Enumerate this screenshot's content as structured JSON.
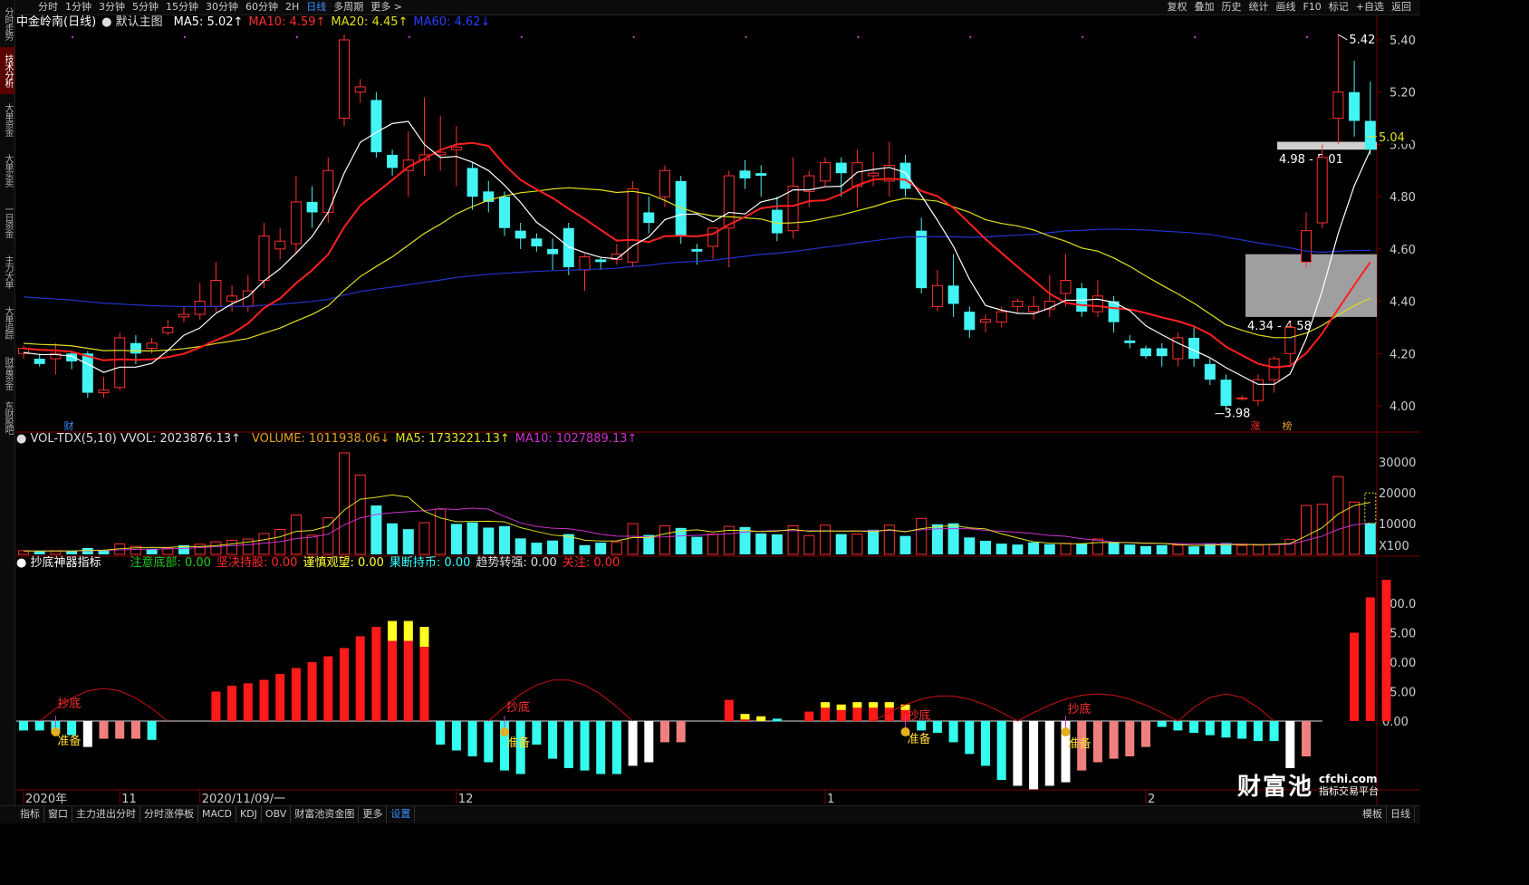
{
  "topbar": {
    "left": [
      "分时",
      "1分钟",
      "3分钟",
      "5分钟",
      "15分钟",
      "30分钟",
      "60分钟",
      "2H",
      "日线",
      "多周期",
      "更多 >"
    ],
    "active": "日线",
    "right": [
      "复权",
      "叠加",
      "历史",
      "统计",
      "画线",
      "F10",
      "标记",
      "+自选",
      "返回"
    ]
  },
  "leftbar": {
    "items": [
      "分时走势",
      "技术分析",
      "大单资金",
      "大单买卖",
      "一日资金",
      "主力大单",
      "大单追踪",
      "财富资金",
      "东财股吧"
    ],
    "active": "技术分析"
  },
  "bottombar": {
    "left": [
      "指标",
      "窗口",
      "主力进出分时",
      "分时涨停板",
      "MACD",
      "KDJ",
      "OBV",
      "财富池资金图",
      "更多",
      "设置"
    ],
    "active": "设置",
    "right": [
      "模板",
      "日线"
    ]
  },
  "header_main": {
    "title": "中金岭南(日线)",
    "template": "默认主图",
    "ma5": "MA5: 5.02↑",
    "ma10": "MA10: 4.59↑",
    "ma20": "MA20: 4.45↑",
    "ma60": "MA60: 4.62↓"
  },
  "header_vol": {
    "title": "VOL-TDX(5,10) VVOL: 2023876.13↑",
    "volume": "VOLUME: 1011938.06↓",
    "ma5": "MA5: 1733221.13↑",
    "ma10": "MA10: 1027889.13↑"
  },
  "header_ind": {
    "title": "抄底神器指标",
    "items": [
      {
        "text": "注意底部: 0.00",
        "color": "#22cc22"
      },
      {
        "text": "坚决持股: 0.00",
        "color": "#ff2a2a"
      },
      {
        "text": "谨慎观望: 0.00",
        "color": "#ffff33"
      },
      {
        "text": "果断持币: 0.00",
        "color": "#33ffff"
      },
      {
        "text": "趋势转强: 0.00",
        "color": "#dddddd"
      },
      {
        "text": "关注: 0.00",
        "color": "#ff2a2a"
      }
    ]
  },
  "price_axis": [
    "5.40",
    "5.20",
    "5.00",
    "4.80",
    "4.60",
    "4.40",
    "4.20",
    "4.00"
  ],
  "price_axis_vals": [
    5.4,
    5.2,
    5.0,
    4.8,
    4.6,
    4.4,
    4.2,
    4.0
  ],
  "vol_axis": [
    "30000",
    "20000",
    "10000",
    "X100"
  ],
  "vol_axis_vals": [
    30000,
    20000,
    10000
  ],
  "ind_axis": [
    "100.0",
    "75.00",
    "50.00",
    "25.00",
    "0.00"
  ],
  "ind_axis_vals": [
    100,
    75,
    50,
    25,
    0
  ],
  "date_axis": [
    {
      "label": "2020年",
      "i": 0
    },
    {
      "label": "11",
      "i": 6
    },
    {
      "label": "2020/11/09/一",
      "i": 11
    },
    {
      "label": "12",
      "i": 27
    },
    {
      "label": "1",
      "i": 50
    },
    {
      "label": "2",
      "i": 70
    }
  ],
  "annotations": {
    "high": "5.42",
    "low": "3.98",
    "last": "5.04",
    "zone1": "4.98 - 5.01",
    "zone2": "4.34 - 4.58",
    "cai": "财",
    "zhang": "涨",
    "bang": "榜",
    "chaodi": "抄底",
    "zhunbei": "准备"
  },
  "colors": {
    "up": "#ff3030",
    "down": "#44f4f4",
    "ma5": "#ffffff",
    "ma10": "#ff2020",
    "ma20": "#e0e020",
    "ma60": "#2233cc",
    "vol_ma5": "#e0e020",
    "vol_ma10": "#cc33cc"
  },
  "watermark": {
    "logo": "财富池",
    "site": "cfchi.com",
    "slogan": "指标交易平台"
  },
  "chart_data": {
    "type": "candlestick",
    "candles": [
      [
        4.2,
        4.22,
        4.18,
        4.23
      ],
      [
        4.18,
        4.16,
        4.15,
        4.2
      ],
      [
        4.18,
        4.2,
        4.12,
        4.24
      ],
      [
        4.2,
        4.17,
        4.14,
        4.21
      ],
      [
        4.2,
        4.05,
        4.03,
        4.21
      ],
      [
        4.05,
        4.06,
        4.03,
        4.11
      ],
      [
        4.07,
        4.26,
        4.06,
        4.28
      ],
      [
        4.24,
        4.2,
        4.16,
        4.27
      ],
      [
        4.22,
        4.24,
        4.2,
        4.26
      ],
      [
        4.28,
        4.3,
        4.27,
        4.33
      ],
      [
        4.34,
        4.35,
        4.32,
        4.38
      ],
      [
        4.35,
        4.4,
        4.33,
        4.47
      ],
      [
        4.38,
        4.48,
        4.36,
        4.55
      ],
      [
        4.4,
        4.42,
        4.36,
        4.46
      ],
      [
        4.38,
        4.44,
        4.36,
        4.5
      ],
      [
        4.48,
        4.65,
        4.45,
        4.7
      ],
      [
        4.6,
        4.63,
        4.56,
        4.68
      ],
      [
        4.62,
        4.78,
        4.58,
        4.88
      ],
      [
        4.78,
        4.74,
        4.68,
        4.84
      ],
      [
        4.74,
        4.9,
        4.7,
        4.95
      ],
      [
        5.1,
        5.4,
        5.07,
        5.42
      ],
      [
        5.2,
        5.22,
        5.16,
        5.25
      ],
      [
        5.17,
        4.97,
        4.95,
        5.2
      ],
      [
        4.96,
        4.91,
        4.88,
        4.98
      ],
      [
        4.9,
        4.94,
        4.8,
        5.05
      ],
      [
        4.94,
        4.96,
        4.88,
        5.18
      ],
      [
        4.96,
        4.97,
        4.9,
        5.11
      ],
      [
        4.98,
        4.99,
        4.84,
        5.07
      ],
      [
        4.91,
        4.8,
        4.75,
        4.93
      ],
      [
        4.82,
        4.78,
        4.74,
        4.86
      ],
      [
        4.8,
        4.68,
        4.65,
        4.82
      ],
      [
        4.67,
        4.64,
        4.6,
        4.7
      ],
      [
        4.64,
        4.61,
        4.59,
        4.66
      ],
      [
        4.6,
        4.58,
        4.52,
        4.64
      ],
      [
        4.68,
        4.53,
        4.5,
        4.7
      ],
      [
        4.52,
        4.57,
        4.44,
        4.58
      ],
      [
        4.56,
        4.55,
        4.52,
        4.57
      ],
      [
        4.56,
        4.58,
        4.54,
        4.62
      ],
      [
        4.55,
        4.83,
        4.53,
        4.86
      ],
      [
        4.74,
        4.7,
        4.66,
        4.8
      ],
      [
        4.8,
        4.9,
        4.76,
        4.92
      ],
      [
        4.86,
        4.65,
        4.62,
        4.88
      ],
      [
        4.6,
        4.59,
        4.54,
        4.62
      ],
      [
        4.61,
        4.68,
        4.56,
        4.66
      ],
      [
        4.68,
        4.88,
        4.53,
        4.9
      ],
      [
        4.9,
        4.87,
        4.83,
        4.94
      ],
      [
        4.89,
        4.88,
        4.8,
        4.92
      ],
      [
        4.75,
        4.66,
        4.63,
        4.8
      ],
      [
        4.67,
        4.84,
        4.64,
        4.95
      ],
      [
        4.82,
        4.88,
        4.76,
        4.9
      ],
      [
        4.86,
        4.93,
        4.84,
        4.95
      ],
      [
        4.93,
        4.89,
        4.8,
        4.95
      ],
      [
        4.84,
        4.93,
        4.76,
        4.98
      ],
      [
        4.88,
        4.89,
        4.84,
        4.97
      ],
      [
        4.86,
        4.92,
        4.8,
        5.01
      ],
      [
        4.93,
        4.83,
        4.8,
        4.96
      ],
      [
        4.67,
        4.45,
        4.43,
        4.72
      ],
      [
        4.38,
        4.46,
        4.36,
        4.52
      ],
      [
        4.46,
        4.39,
        4.34,
        4.58
      ],
      [
        4.36,
        4.29,
        4.26,
        4.38
      ],
      [
        4.32,
        4.33,
        4.28,
        4.35
      ],
      [
        4.32,
        4.36,
        4.3,
        4.38
      ],
      [
        4.38,
        4.4,
        4.35,
        4.41
      ],
      [
        4.36,
        4.38,
        4.33,
        4.42
      ],
      [
        4.37,
        4.4,
        4.34,
        4.5
      ],
      [
        4.43,
        4.48,
        4.38,
        4.58
      ],
      [
        4.45,
        4.36,
        4.34,
        4.47
      ],
      [
        4.36,
        4.42,
        4.34,
        4.48
      ],
      [
        4.4,
        4.32,
        4.28,
        4.42
      ],
      [
        4.25,
        4.24,
        4.22,
        4.27
      ],
      [
        4.22,
        4.19,
        4.18,
        4.23
      ],
      [
        4.22,
        4.19,
        4.15,
        4.24
      ],
      [
        4.18,
        4.26,
        4.15,
        4.28
      ],
      [
        4.26,
        4.18,
        4.15,
        4.3
      ],
      [
        4.16,
        4.1,
        4.08,
        4.18
      ],
      [
        4.1,
        4.0,
        3.98,
        4.12
      ],
      [
        4.03,
        4.03,
        4.02,
        4.04
      ],
      [
        4.02,
        4.1,
        4.0,
        4.12
      ],
      [
        4.1,
        4.18,
        4.05,
        4.19
      ],
      [
        4.2,
        4.3,
        4.16,
        4.32
      ],
      [
        4.55,
        4.67,
        4.53,
        4.74
      ],
      [
        4.7,
        4.95,
        4.68,
        5.0
      ],
      [
        5.1,
        5.2,
        5.0,
        5.42
      ],
      [
        5.2,
        5.09,
        5.03,
        5.32
      ],
      [
        5.09,
        4.98,
        4.96,
        5.24
      ]
    ],
    "volume": [
      [
        1200,
        1
      ],
      [
        1000,
        0
      ],
      [
        1200,
        1
      ],
      [
        1100,
        0
      ],
      [
        2100,
        0
      ],
      [
        1500,
        0
      ],
      [
        3400,
        1
      ],
      [
        2600,
        1
      ],
      [
        1800,
        0
      ],
      [
        2000,
        1
      ],
      [
        3000,
        0
      ],
      [
        3300,
        1
      ],
      [
        4100,
        1
      ],
      [
        4600,
        1
      ],
      [
        5000,
        1
      ],
      [
        6800,
        1
      ],
      [
        8100,
        1
      ],
      [
        12800,
        1
      ],
      [
        6200,
        1
      ],
      [
        11900,
        1
      ],
      [
        33000,
        1
      ],
      [
        25800,
        1
      ],
      [
        15900,
        0
      ],
      [
        10100,
        0
      ],
      [
        8200,
        0
      ],
      [
        10300,
        1
      ],
      [
        14700,
        1
      ],
      [
        9900,
        0
      ],
      [
        10400,
        0
      ],
      [
        8700,
        0
      ],
      [
        9200,
        0
      ],
      [
        5200,
        0
      ],
      [
        3800,
        0
      ],
      [
        4500,
        0
      ],
      [
        6600,
        0
      ],
      [
        3000,
        0
      ],
      [
        3800,
        0
      ],
      [
        4100,
        1
      ],
      [
        10000,
        1
      ],
      [
        6300,
        0
      ],
      [
        9300,
        1
      ],
      [
        8600,
        0
      ],
      [
        5700,
        0
      ],
      [
        6600,
        1
      ],
      [
        9100,
        1
      ],
      [
        8900,
        0
      ],
      [
        6800,
        0
      ],
      [
        6500,
        0
      ],
      [
        9300,
        1
      ],
      [
        6100,
        1
      ],
      [
        9500,
        1
      ],
      [
        6600,
        0
      ],
      [
        6600,
        1
      ],
      [
        8000,
        0
      ],
      [
        9500,
        1
      ],
      [
        6000,
        0
      ],
      [
        11700,
        1
      ],
      [
        9800,
        0
      ],
      [
        10100,
        0
      ],
      [
        5500,
        0
      ],
      [
        4400,
        0
      ],
      [
        3500,
        0
      ],
      [
        3200,
        0
      ],
      [
        3900,
        0
      ],
      [
        3300,
        0
      ],
      [
        3600,
        1
      ],
      [
        3400,
        0
      ],
      [
        5000,
        1
      ],
      [
        4000,
        0
      ],
      [
        3200,
        0
      ],
      [
        2700,
        0
      ],
      [
        3000,
        0
      ],
      [
        3000,
        1
      ],
      [
        2600,
        0
      ],
      [
        3600,
        0
      ],
      [
        3700,
        0
      ],
      [
        2900,
        1
      ],
      [
        3000,
        1
      ],
      [
        3200,
        1
      ],
      [
        4900,
        1
      ],
      [
        15900,
        1
      ],
      [
        16300,
        1
      ],
      [
        25300,
        1
      ],
      [
        17000,
        1
      ],
      [
        10100,
        0
      ]
    ],
    "indicator": [
      [
        -8,
        "c"
      ],
      [
        -8,
        "c"
      ],
      [
        -10,
        "c"
      ],
      [
        -12,
        "c"
      ],
      [
        -22,
        "w"
      ],
      [
        -15,
        "p"
      ],
      [
        -15,
        "p"
      ],
      [
        -15,
        "p"
      ],
      [
        -16,
        "c"
      ],
      [
        0,
        "n"
      ],
      [
        0,
        "n"
      ],
      [
        0,
        "n"
      ],
      [
        25,
        "r"
      ],
      [
        30,
        "r"
      ],
      [
        32,
        "r"
      ],
      [
        35,
        "r"
      ],
      [
        40,
        "r"
      ],
      [
        45,
        "r"
      ],
      [
        50,
        "r"
      ],
      [
        55,
        "r"
      ],
      [
        62,
        "r"
      ],
      [
        72,
        "r"
      ],
      [
        80,
        "r"
      ],
      [
        85,
        "ry"
      ],
      [
        85,
        "ry"
      ],
      [
        80,
        "ry"
      ],
      [
        -20,
        "c"
      ],
      [
        -25,
        "c"
      ],
      [
        -30,
        "c"
      ],
      [
        -35,
        "c"
      ],
      [
        -42,
        "c"
      ],
      [
        -45,
        "c"
      ],
      [
        -20,
        "c"
      ],
      [
        -32,
        "c"
      ],
      [
        -40,
        "c"
      ],
      [
        -42,
        "c"
      ],
      [
        -45,
        "c"
      ],
      [
        -45,
        "c"
      ],
      [
        -38,
        "w"
      ],
      [
        -35,
        "w"
      ],
      [
        -18,
        "p"
      ],
      [
        -18,
        "p"
      ],
      [
        0,
        "n"
      ],
      [
        0,
        "n"
      ],
      [
        18,
        "r"
      ],
      [
        6,
        "ry"
      ],
      [
        4,
        "ry"
      ],
      [
        2,
        "c"
      ],
      [
        0,
        "n"
      ],
      [
        8,
        "r"
      ],
      [
        16,
        "ry"
      ],
      [
        14,
        "ry"
      ],
      [
        16,
        "ry"
      ],
      [
        16,
        "ry"
      ],
      [
        16,
        "ry"
      ],
      [
        14,
        "ry"
      ],
      [
        -8,
        "c"
      ],
      [
        -10,
        "c"
      ],
      [
        -18,
        "c"
      ],
      [
        -28,
        "c"
      ],
      [
        -38,
        "c"
      ],
      [
        -50,
        "c"
      ],
      [
        -55,
        "w"
      ],
      [
        -58,
        "w"
      ],
      [
        -55,
        "w"
      ],
      [
        -52,
        "w"
      ],
      [
        -42,
        "p"
      ],
      [
        -35,
        "p"
      ],
      [
        -32,
        "p"
      ],
      [
        -30,
        "p"
      ],
      [
        -22,
        "p"
      ],
      [
        -5,
        "c"
      ],
      [
        -8,
        "c"
      ],
      [
        -10,
        "c"
      ],
      [
        -12,
        "c"
      ],
      [
        -14,
        "c"
      ],
      [
        -15,
        "c"
      ],
      [
        -17,
        "c"
      ],
      [
        -17,
        "c"
      ],
      [
        -40,
        "w"
      ],
      [
        -30,
        "p"
      ],
      [
        0,
        "n"
      ],
      [
        0,
        "n"
      ],
      [
        75,
        "r"
      ],
      [
        105,
        "r"
      ],
      [
        120,
        "r"
      ]
    ]
  }
}
